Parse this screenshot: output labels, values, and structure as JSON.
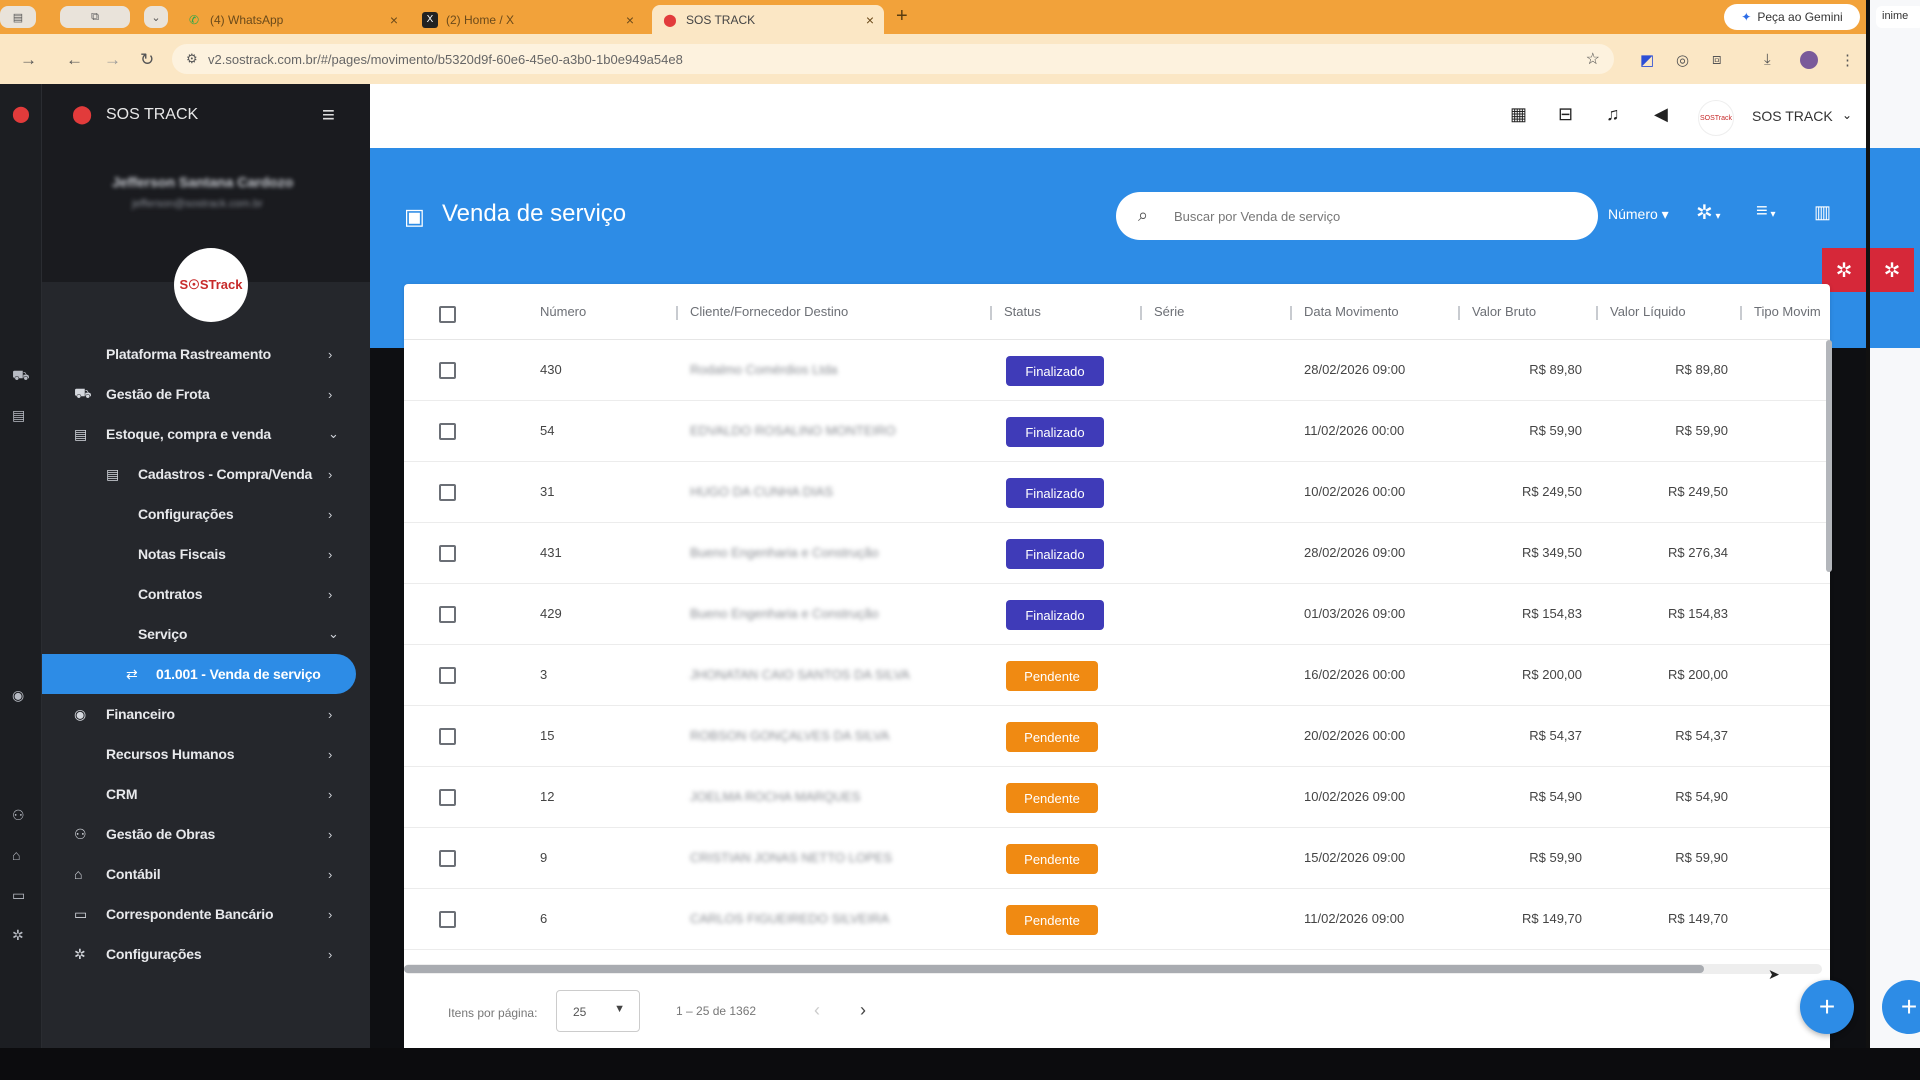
{
  "browser": {
    "tabs": [
      {
        "title": "(4) WhatsApp",
        "icon": "whatsapp-icon"
      },
      {
        "title": "(2) Home / X",
        "icon": "x-logo-icon"
      },
      {
        "title": "SOS TRACK",
        "icon": "location-pin-icon"
      }
    ],
    "new_tab": "+",
    "gemini": "Peça ao Gemini",
    "url": "v2.sostrack.com.br/#/pages/movimento/b5320d9f-60e6-45e0-a3b0-1b0e949a54e8",
    "right_tab": "inime"
  },
  "sidebar": {
    "brand": "SOS TRACK",
    "user_name": "Jefferson Santana Cardozo",
    "user_email": "jefferson@sostrack.com.br",
    "avatar_text": "S☉STrack",
    "items": [
      {
        "label": "Plataforma Rastreamento",
        "chev": "›"
      },
      {
        "label": "Gestão de Frota",
        "chev": "›",
        "icon": "truck-icon"
      },
      {
        "label": "Estoque, compra e venda",
        "chev": "⌄",
        "icon": "box-icon"
      },
      {
        "label": "Cadastros - Compra/Venda",
        "chev": "›",
        "icon": "list-icon"
      },
      {
        "label": "Configurações",
        "chev": "›"
      },
      {
        "label": "Notas Fiscais",
        "chev": "›"
      },
      {
        "label": "Contratos",
        "chev": "›"
      },
      {
        "label": "Serviço",
        "chev": "⌄"
      },
      {
        "label": "01.001 - Venda de serviço",
        "chev": ""
      },
      {
        "label": "Financeiro",
        "chev": "›",
        "icon": "money-icon"
      },
      {
        "label": "Recursos Humanos",
        "chev": "›"
      },
      {
        "label": "CRM",
        "chev": "›"
      },
      {
        "label": "Gestão de Obras",
        "chev": "›",
        "icon": "workers-icon"
      },
      {
        "label": "Contábil",
        "chev": "›",
        "icon": "bank-icon"
      },
      {
        "label": "Correspondente Bancário",
        "chev": "›",
        "icon": "card-icon"
      },
      {
        "label": "Configurações",
        "chev": "›",
        "icon": "gear-icon"
      }
    ]
  },
  "header": {
    "user": "SOS TRACK",
    "avatar_text": "SOSTrack"
  },
  "page": {
    "title": "Venda de serviço",
    "search_placeholder": "Buscar por Venda de serviço",
    "sort_field": "Número"
  },
  "table": {
    "columns": [
      "Número",
      "Cliente/Fornecedor Destino",
      "Status",
      "Série",
      "Data Movimento",
      "Valor Bruto",
      "Valor Líquido",
      "Tipo Movim"
    ],
    "rows": [
      {
        "numero": "430",
        "cliente": "Rodalmo Comérdios Ltda",
        "status": "Finalizado",
        "data": "28/02/2026 09:00",
        "bruto": "R$ 89,80",
        "liquido": "R$ 89,80"
      },
      {
        "numero": "54",
        "cliente": "EDVALDO ROSALINO MONTEIRO",
        "status": "Finalizado",
        "data": "11/02/2026 00:00",
        "bruto": "R$ 59,90",
        "liquido": "R$ 59,90"
      },
      {
        "numero": "31",
        "cliente": "HUGO DA CUNHA DIAS",
        "status": "Finalizado",
        "data": "10/02/2026 00:00",
        "bruto": "R$ 249,50",
        "liquido": "R$ 249,50"
      },
      {
        "numero": "431",
        "cliente": "Bueno Engenharia e Construção",
        "status": "Finalizado",
        "data": "28/02/2026 09:00",
        "bruto": "R$ 349,50",
        "liquido": "R$ 276,34"
      },
      {
        "numero": "429",
        "cliente": "Bueno Engenharia e Construção",
        "status": "Finalizado",
        "data": "01/03/2026 09:00",
        "bruto": "R$ 154,83",
        "liquido": "R$ 154,83"
      },
      {
        "numero": "3",
        "cliente": "JHONATAN CAIO SANTOS DA SILVA",
        "status": "Pendente",
        "data": "16/02/2026 00:00",
        "bruto": "R$ 200,00",
        "liquido": "R$ 200,00"
      },
      {
        "numero": "15",
        "cliente": "ROBSON GONÇALVES DA SILVA",
        "status": "Pendente",
        "data": "20/02/2026 00:00",
        "bruto": "R$ 54,37",
        "liquido": "R$ 54,37"
      },
      {
        "numero": "12",
        "cliente": "JOELMA ROCHA MARQUES",
        "status": "Pendente",
        "data": "10/02/2026 09:00",
        "bruto": "R$ 54,90",
        "liquido": "R$ 54,90"
      },
      {
        "numero": "9",
        "cliente": "CRISTIAN JONAS NETTO LOPES",
        "status": "Pendente",
        "data": "15/02/2026 09:00",
        "bruto": "R$ 59,90",
        "liquido": "R$ 59,90"
      },
      {
        "numero": "6",
        "cliente": "CARLOS FIGUEIREDO SILVEIRA",
        "status": "Pendente",
        "data": "11/02/2026 09:00",
        "bruto": "R$ 149,70",
        "liquido": "R$ 149,70"
      }
    ]
  },
  "paginator": {
    "label": "Itens por página:",
    "page_size": "25",
    "range": "1 – 25 de 1362"
  },
  "colors": {
    "primary": "#2d8ce6",
    "finalizado": "#3f3bb8",
    "pendente": "#f08a12",
    "danger": "#d62839",
    "tabbar": "#f2a23a"
  }
}
